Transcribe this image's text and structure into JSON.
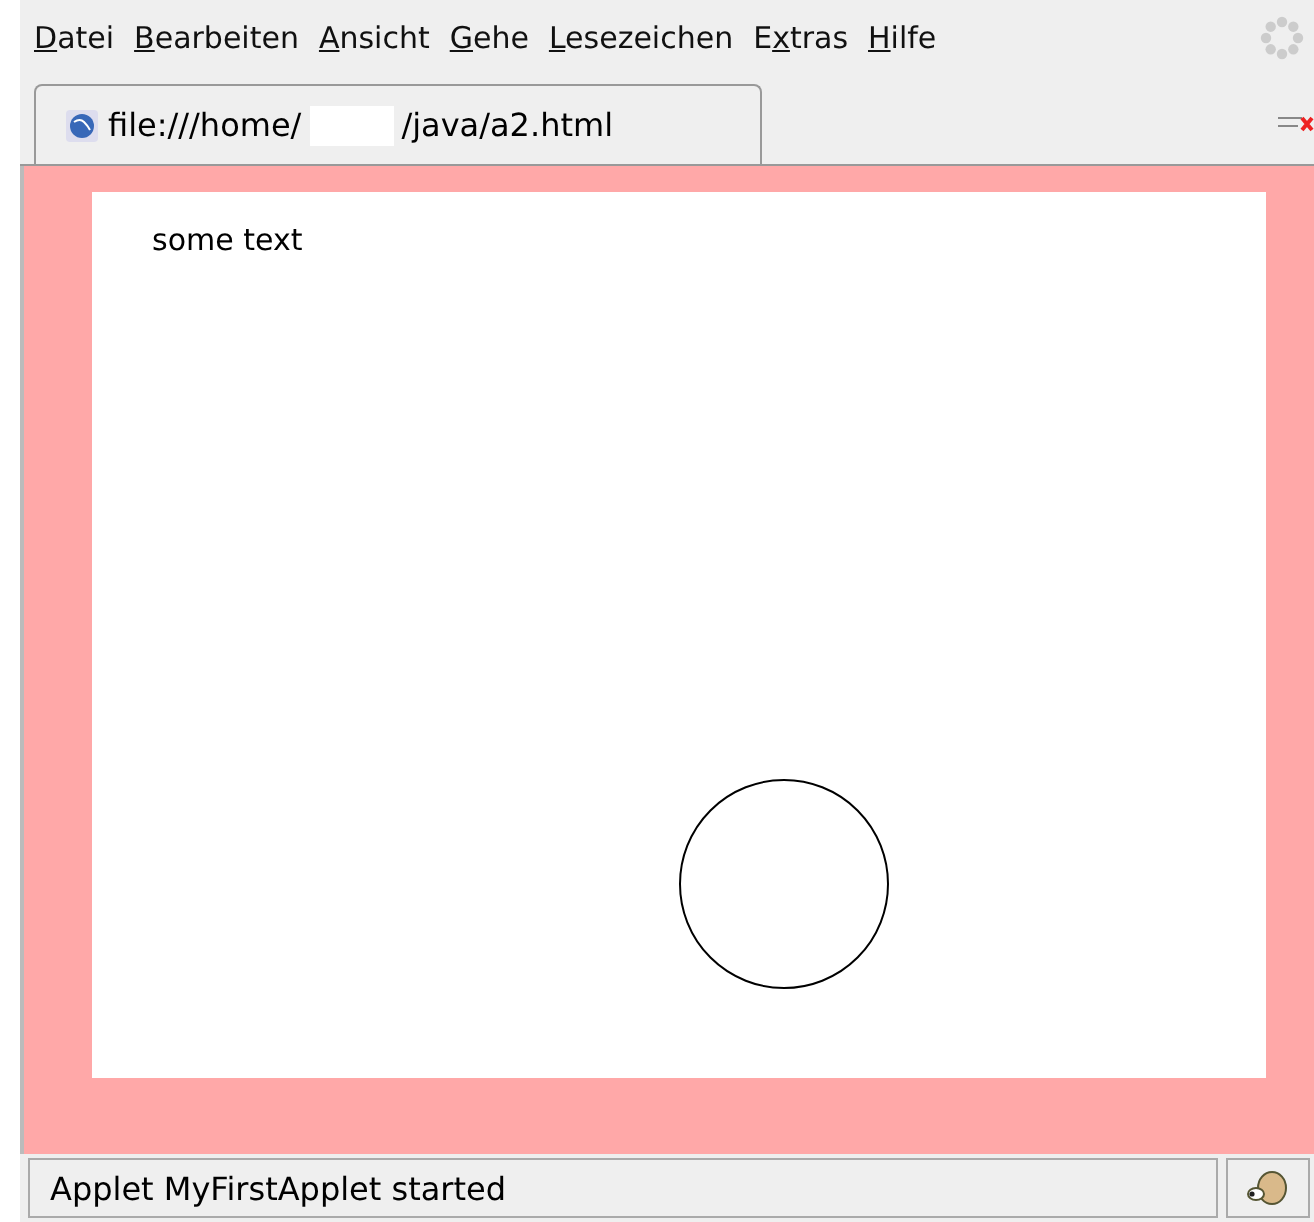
{
  "menu": [
    {
      "key": "D",
      "after": "atei"
    },
    {
      "key": "B",
      "after": "earbeiten"
    },
    {
      "key": "A",
      "after": "nsicht"
    },
    {
      "key": "G",
      "after": "ehe"
    },
    {
      "key": "L",
      "after": "esezeichen"
    },
    {
      "before": "E",
      "key": "x",
      "after": "tras"
    },
    {
      "key": "H",
      "after": "ilfe"
    }
  ],
  "tab": {
    "url_start": "file:///home/",
    "url_end": "/java/a2.html",
    "selected": true
  },
  "applet": {
    "text": "some text"
  },
  "status_bar": {
    "text": "Applet MyFirstApplet started"
  }
}
